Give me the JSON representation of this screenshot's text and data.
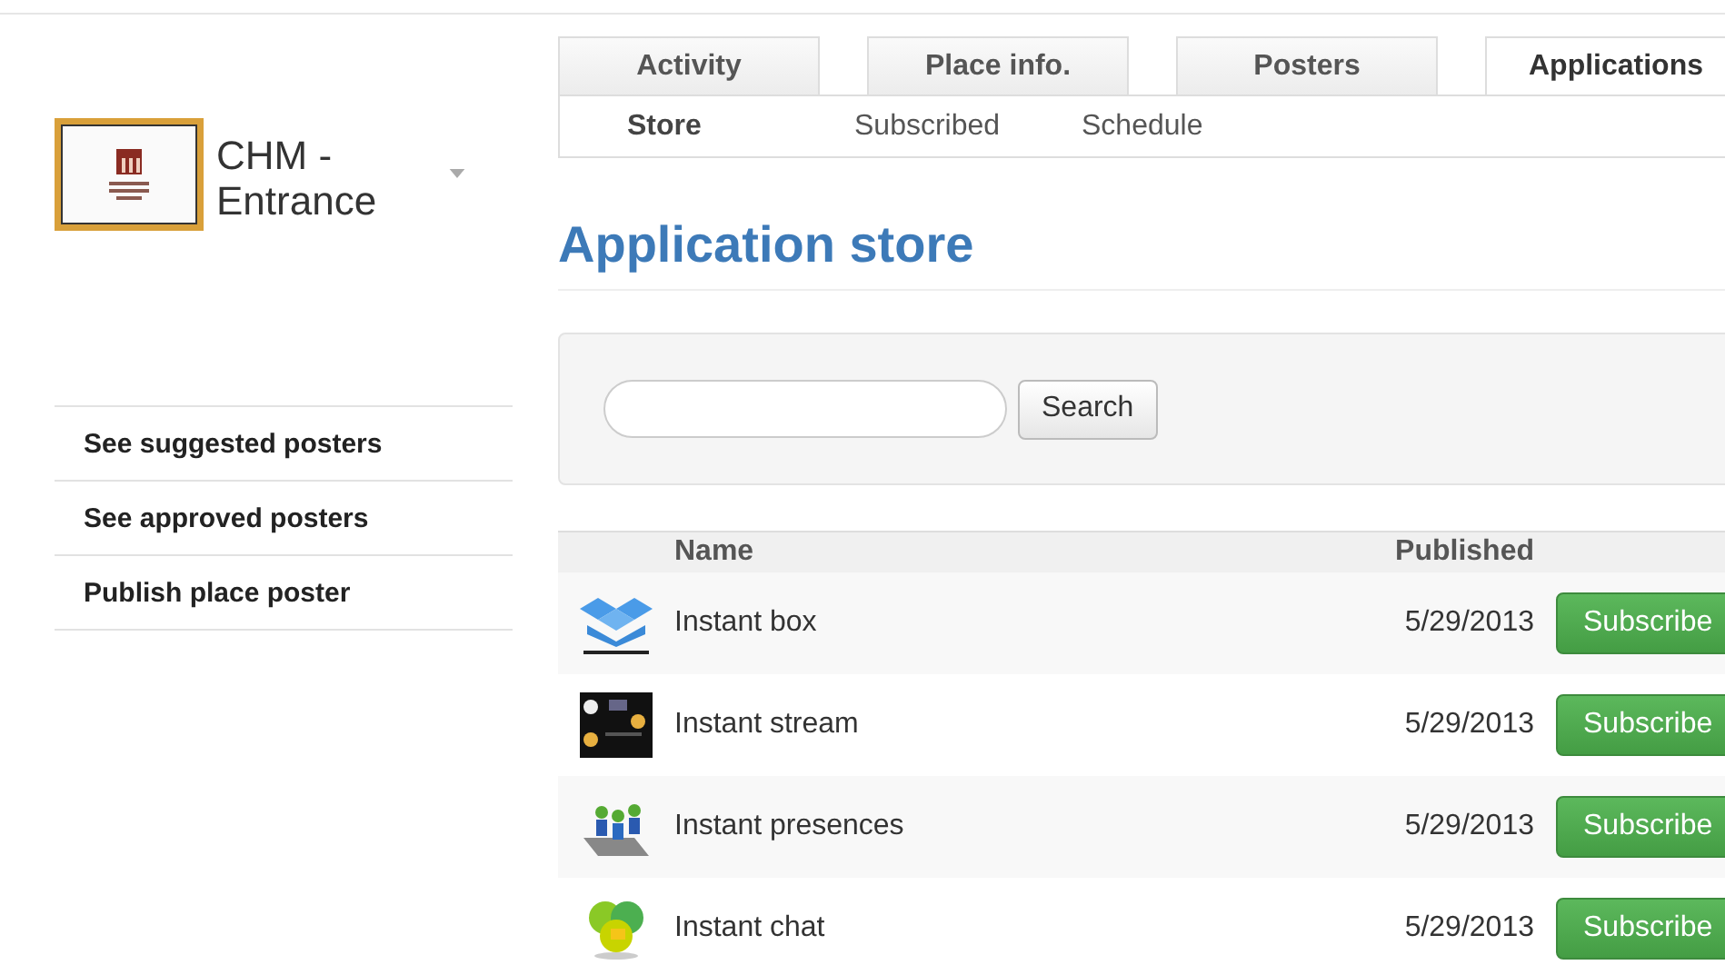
{
  "place": {
    "name_line_1": "CHM -",
    "name_line_2": "Entrance"
  },
  "sidebar": {
    "items": [
      {
        "label": "See suggested posters"
      },
      {
        "label": "See approved posters"
      },
      {
        "label": "Publish place poster"
      }
    ]
  },
  "tabs": [
    {
      "label": "Activity",
      "selected": false
    },
    {
      "label": "Place info.",
      "selected": false
    },
    {
      "label": "Posters",
      "selected": false
    },
    {
      "label": "Applications",
      "selected": true
    }
  ],
  "subtabs": [
    {
      "label": "Store",
      "selected": true
    },
    {
      "label": "Subscribed",
      "selected": false
    },
    {
      "label": "Schedule",
      "selected": false
    }
  ],
  "heading": "Application store",
  "search": {
    "button": "Search"
  },
  "table": {
    "columns": [
      "Name",
      "Published"
    ],
    "rows": [
      {
        "name": "Instant box",
        "published": "5/29/2013",
        "action": "Subscribe"
      },
      {
        "name": "Instant stream",
        "published": "5/29/2013",
        "action": "Subscribe"
      },
      {
        "name": "Instant presences",
        "published": "5/29/2013",
        "action": "Subscribe"
      },
      {
        "name": "Instant chat",
        "published": "5/29/2013",
        "action": "Subscribe"
      }
    ]
  }
}
